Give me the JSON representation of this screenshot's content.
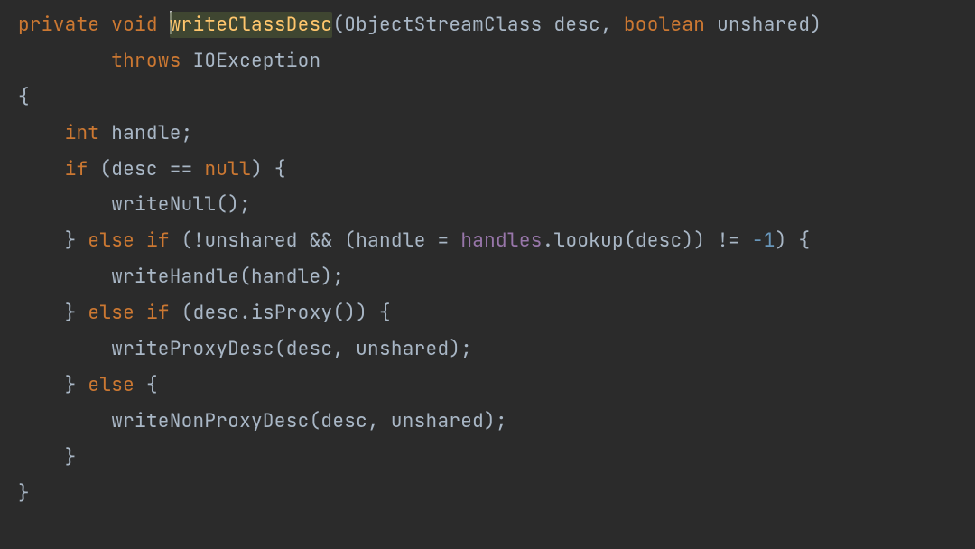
{
  "code": {
    "tokens": {
      "private": "private",
      "void": "void",
      "method_name": "writeClassDesc",
      "param_type1": "ObjectStreamClass",
      "param_name1": "desc",
      "boolean": "boolean",
      "param_name2": "unshared",
      "throws": "throws",
      "exception_type": "IOException",
      "lbrace": "{",
      "rbrace": "}",
      "int": "int",
      "handle": "handle",
      "if": "if",
      "else": "else",
      "lparen": "(",
      "rparen": ")",
      "desc": "desc",
      "eqeq": "==",
      "eq": "=",
      "null": "null",
      "semi": ";",
      "writeNull": "writeNull",
      "writeHandle": "writeHandle",
      "not": "!",
      "andand": "&&",
      "handles_field": "handles",
      "dot": ".",
      "lookup": "lookup",
      "noteq": "!=",
      "neg1": "-1",
      "isProxy": "isProxy",
      "writeProxyDesc": "writeProxyDesc",
      "writeNonProxyDesc": "writeNonProxyDesc",
      "comma": ","
    }
  }
}
